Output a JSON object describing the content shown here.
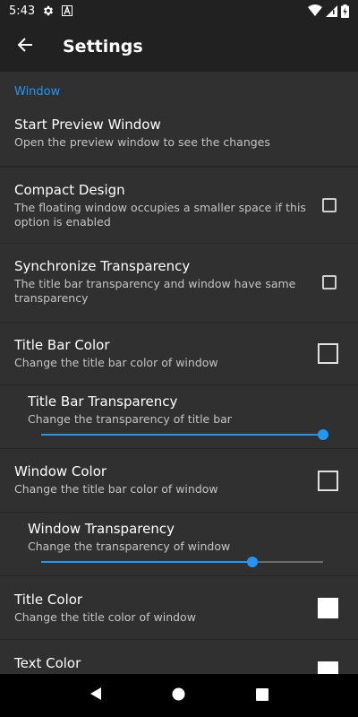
{
  "status_bar": {
    "time": "5:43"
  },
  "app_bar": {
    "title": "Settings"
  },
  "category": {
    "label": "Window"
  },
  "prefs": {
    "start_preview": {
      "title": "Start Preview Window",
      "summary": "Open the preview window to see the changes"
    },
    "compact_design": {
      "title": "Compact Design",
      "summary_line1": "The floating window occupies a smaller space if this",
      "summary_line2": "option is enabled",
      "checked": false
    },
    "sync_transparency": {
      "title": "Synchronize Transparency",
      "summary_line1": "The title bar transparency and window have same",
      "summary_line2": "transparency",
      "checked": false
    },
    "title_bar_color": {
      "title": "Title Bar Color",
      "summary": "Change the title bar color of window",
      "color": "#303030"
    },
    "title_bar_transparency": {
      "title": "Title Bar Transparency",
      "summary": "Change the transparency of title bar",
      "value_fraction": 1.0
    },
    "window_color": {
      "title": "Window Color",
      "summary": "Change the title bar color of window",
      "color": "#303030"
    },
    "window_transparency": {
      "title": "Window Transparency",
      "summary": "Change the transparency of window",
      "value_fraction": 0.75
    },
    "title_color": {
      "title": "Title Color",
      "summary": "Change the title color of window",
      "color": "#ffffff"
    },
    "text_color": {
      "title": "Text Color",
      "color": "#ffffff"
    }
  },
  "theme": {
    "accent": "#2196f3",
    "background": "#303030",
    "app_bar": "#212121"
  }
}
